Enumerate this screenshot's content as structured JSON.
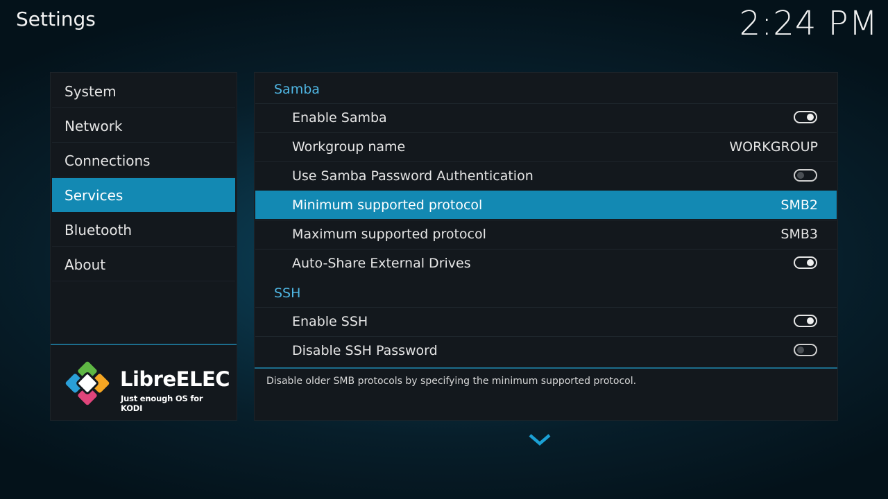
{
  "header": {
    "title": "Settings",
    "clock": "2:24 PM"
  },
  "sidebar": {
    "items": [
      {
        "label": "System"
      },
      {
        "label": "Network"
      },
      {
        "label": "Connections"
      },
      {
        "label": "Services"
      },
      {
        "label": "Bluetooth"
      },
      {
        "label": "About"
      }
    ],
    "selected": "Services",
    "logo": {
      "name": "LibreELEC",
      "tagline": "Just enough OS for KODI",
      "colors": [
        "#5fb744",
        "#f5a623",
        "#2a9fd8",
        "#e0457b"
      ]
    }
  },
  "main": {
    "groups": [
      {
        "title": "Samba"
      },
      {
        "title": "SSH"
      }
    ],
    "rows": [
      {
        "label": "Enable Samba",
        "type": "toggle",
        "state": "on"
      },
      {
        "label": "Workgroup name",
        "type": "value",
        "value": "WORKGROUP"
      },
      {
        "label": "Use Samba Password Authentication",
        "type": "toggle",
        "state": "off"
      },
      {
        "label": "Minimum supported protocol",
        "type": "value",
        "value": "SMB2",
        "selected": true
      },
      {
        "label": "Maximum supported protocol",
        "type": "value",
        "value": "SMB3"
      },
      {
        "label": "Auto-Share External Drives",
        "type": "toggle",
        "state": "on"
      },
      {
        "label": "Enable SSH",
        "type": "toggle",
        "state": "on"
      },
      {
        "label": "Disable SSH Password",
        "type": "toggle",
        "state": "off"
      }
    ],
    "description": "Disable older SMB protocols by specifying the minimum supported protocol."
  },
  "colors": {
    "accent": "#1389b3",
    "group_header": "#4fb6e3"
  },
  "icons": {
    "scroll": "chevron-down-icon"
  }
}
